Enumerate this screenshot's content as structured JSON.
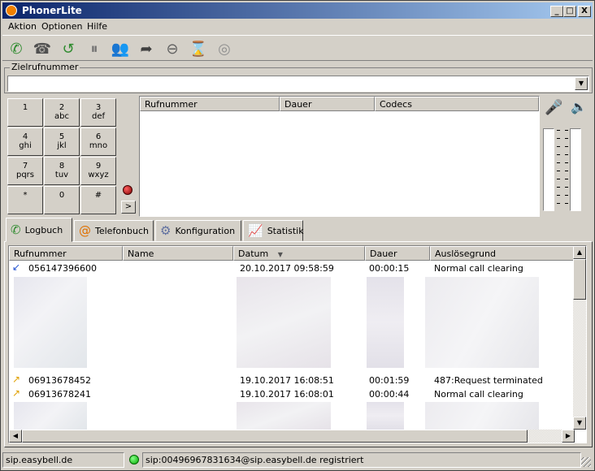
{
  "window": {
    "title": "PhonerLite",
    "minimize": "_",
    "maximize": "□",
    "close": "X"
  },
  "menu": [
    "Aktion",
    "Optionen",
    "Hilfe"
  ],
  "target": {
    "legend": "Zielrufnummer",
    "value": ""
  },
  "keypad": [
    {
      "digit": "1",
      "letters": ""
    },
    {
      "digit": "2",
      "letters": "abc"
    },
    {
      "digit": "3",
      "letters": "def"
    },
    {
      "digit": "4",
      "letters": "ghi"
    },
    {
      "digit": "5",
      "letters": "jkl"
    },
    {
      "digit": "6",
      "letters": "mno"
    },
    {
      "digit": "7",
      "letters": "pqrs"
    },
    {
      "digit": "8",
      "letters": "tuv"
    },
    {
      "digit": "9",
      "letters": "wxyz"
    },
    {
      "digit": "*",
      "letters": ""
    },
    {
      "digit": "0",
      "letters": ""
    },
    {
      "digit": "#",
      "letters": ""
    }
  ],
  "more_button": ">",
  "calls": {
    "columns": [
      "Rufnummer",
      "Dauer",
      "Codecs"
    ]
  },
  "tabs": [
    {
      "label": "Logbuch",
      "icon": "phone-log-icon",
      "active": true
    },
    {
      "label": "Telefonbuch",
      "icon": "phonebook-icon",
      "active": false
    },
    {
      "label": "Konfiguration",
      "icon": "gear-icon",
      "active": false
    },
    {
      "label": "Statistik",
      "icon": "chart-icon",
      "active": false
    }
  ],
  "log": {
    "columns": [
      "Rufnummer",
      "Name",
      "Datum",
      "Dauer",
      "Auslösegrund"
    ],
    "sort_indicator": "▼",
    "rows": [
      {
        "type": "incoming",
        "number": "056147396600",
        "name": "",
        "date": "20.10.2017 09:58:59",
        "duration": "00:00:15",
        "reason": "Normal call clearing"
      },
      {
        "type": "outgoing",
        "number": "06913678452",
        "name": "",
        "date": "19.10.2017 16:08:51",
        "duration": "00:01:59",
        "reason": "487:Request terminated"
      },
      {
        "type": "outgoing",
        "number": "06913678241",
        "name": "",
        "date": "19.10.2017 16:08:01",
        "duration": "00:00:44",
        "reason": "Normal call clearing"
      }
    ]
  },
  "status": {
    "server": "sip.easybell.de",
    "registration": "sip:00496967831634@sip.easybell.de registriert"
  },
  "colors": {
    "title_start": "#0a246a",
    "title_end": "#a6caf0",
    "toolbar_green": "#2e8b2e",
    "status_led": "#00aa00"
  }
}
